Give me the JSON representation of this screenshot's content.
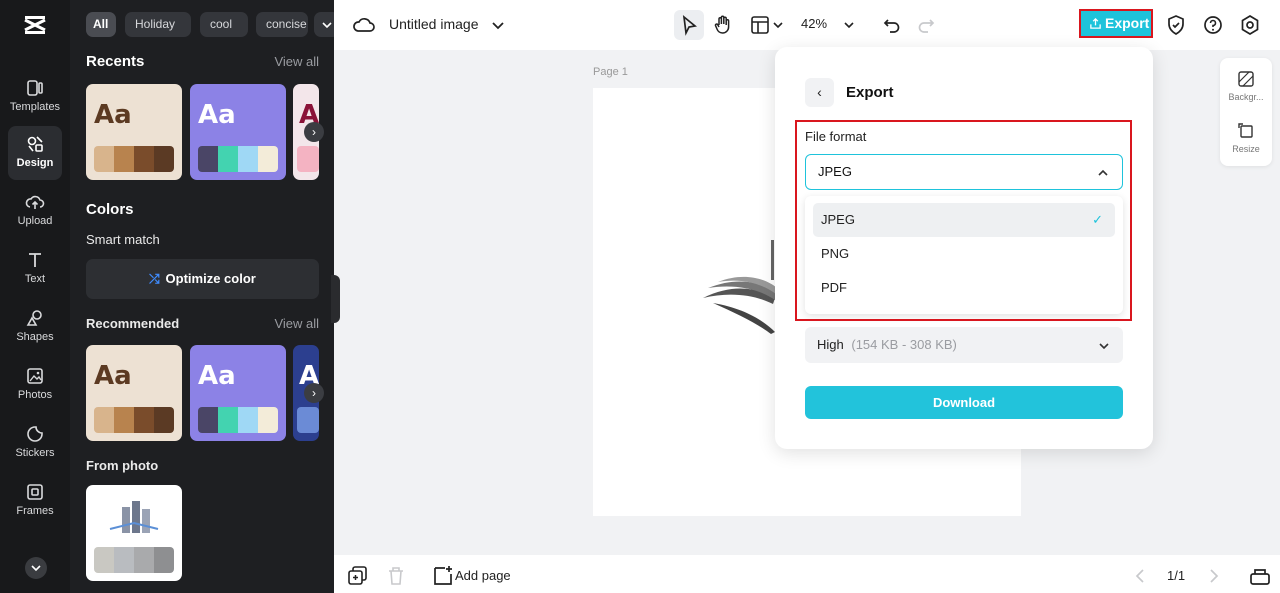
{
  "app": {
    "doc_title": "Untitled image",
    "zoom": "42%"
  },
  "rail": {
    "items": [
      {
        "label": "Templates"
      },
      {
        "label": "Design"
      },
      {
        "label": "Upload"
      },
      {
        "label": "Text"
      },
      {
        "label": "Shapes"
      },
      {
        "label": "Photos"
      },
      {
        "label": "Stickers"
      },
      {
        "label": "Frames"
      }
    ]
  },
  "panel": {
    "chips": [
      "All",
      "Holiday",
      "cool",
      "concise"
    ],
    "recents_title": "Recents",
    "view_all": "View all",
    "colors_title": "Colors",
    "smart_match": "Smart match",
    "optimize_label": "Optimize color",
    "recommended_title": "Recommended",
    "from_photo": "From photo",
    "card_text": "Aa",
    "card_text_cut": "A"
  },
  "topbar": {
    "export_label": "Export"
  },
  "canvas": {
    "page_label": "Page 1"
  },
  "side_tools": {
    "background": "Backgr...",
    "resize": "Resize"
  },
  "bottombar": {
    "add_page": "Add page",
    "pager": "1/1"
  },
  "export_panel": {
    "title": "Export",
    "file_format_label": "File format",
    "selected_format": "JPEG",
    "options": [
      "JPEG",
      "PNG",
      "PDF"
    ],
    "quality_value": "High",
    "quality_detail": "(154 KB - 308 KB)",
    "download_label": "Download"
  },
  "colors": {
    "accent": "#1ec3db",
    "highlight": "#d9161e",
    "rail_bg": "#18191b",
    "panel_bg": "#1e1f22"
  }
}
